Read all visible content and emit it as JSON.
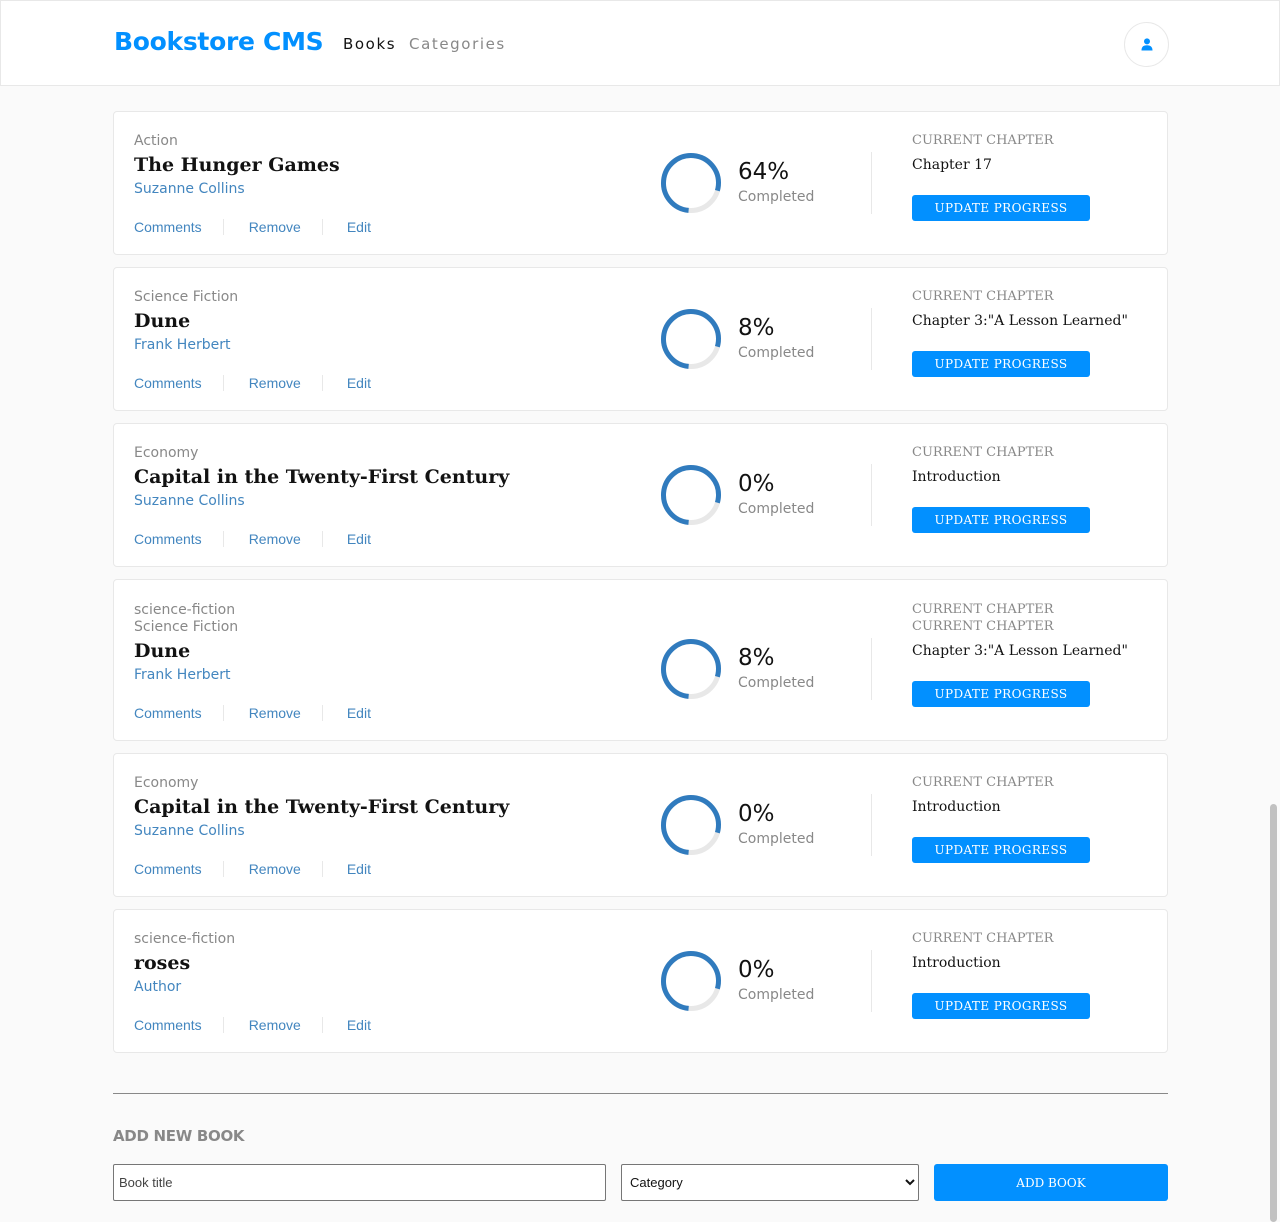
{
  "header": {
    "logo": "Bookstore CMS",
    "nav": [
      {
        "label": "Books",
        "active": true
      },
      {
        "label": "Categories",
        "active": false
      }
    ],
    "user_icon": "user-icon"
  },
  "books": [
    {
      "genre": "Action",
      "title": "The Hunger Games",
      "author": "Suzanne Collins",
      "progress": 64,
      "percent": "64%",
      "completed": "Completed",
      "chapter_label": "CURRENT CHAPTER",
      "chapter": "Chapter 17",
      "update_label": "UPDATE PROGRESS",
      "actions": {
        "comments": "Comments",
        "remove": "Remove",
        "edit": "Edit"
      }
    },
    {
      "genre": "Science Fiction",
      "title": "Dune",
      "author": "Frank Herbert",
      "progress": 8,
      "percent": "8%",
      "completed": "Completed",
      "chapter_label": "CURRENT CHAPTER",
      "chapter": "Chapter 3:\"A Lesson Learned\"",
      "update_label": "UPDATE PROGRESS",
      "actions": {
        "comments": "Comments",
        "remove": "Remove",
        "edit": "Edit"
      }
    },
    {
      "genre": "Economy",
      "title": "Capital in the Twenty-First Century",
      "author": "Suzanne Collins",
      "progress": 0,
      "percent": "0%",
      "completed": "Completed",
      "chapter_label": "CURRENT CHAPTER",
      "chapter": "Introduction",
      "update_label": "UPDATE PROGRESS",
      "actions": {
        "comments": "Comments",
        "remove": "Remove",
        "edit": "Edit"
      }
    },
    {
      "ghost_genre": "science-fiction",
      "ghost_chapter_label": "CURRENT CHAPTER",
      "genre": "Science Fiction",
      "title": "Dune",
      "author": "Frank Herbert",
      "progress": 8,
      "percent": "8%",
      "completed": "Completed",
      "chapter_label": "CURRENT CHAPTER",
      "chapter": "Chapter 3:\"A Lesson Learned\"",
      "update_label": "UPDATE PROGRESS",
      "actions": {
        "comments": "Comments",
        "remove": "Remove",
        "edit": "Edit"
      }
    },
    {
      "genre": "Economy",
      "title": "Capital in the Twenty-First Century",
      "author": "Suzanne Collins",
      "progress": 0,
      "percent": "0%",
      "completed": "Completed",
      "chapter_label": "CURRENT CHAPTER",
      "chapter": "Introduction",
      "update_label": "UPDATE PROGRESS",
      "actions": {
        "comments": "Comments",
        "remove": "Remove",
        "edit": "Edit"
      }
    },
    {
      "genre": "science-fiction",
      "title": "roses",
      "author": "Author",
      "progress": 0,
      "percent": "0%",
      "completed": "Completed",
      "chapter_label": "CURRENT CHAPTER",
      "chapter": "Introduction",
      "update_label": "UPDATE PROGRESS",
      "actions": {
        "comments": "Comments",
        "remove": "Remove",
        "edit": "Edit"
      }
    }
  ],
  "form": {
    "title": "ADD NEW BOOK",
    "title_placeholder": "Book title",
    "category_selected": "Category",
    "add_label": "ADD BOOK"
  },
  "colors": {
    "accent": "#0290ff",
    "author": "#4386bf",
    "muted": "#888888",
    "ring_track": "#e8e8e8",
    "ring_fill": "#307bbe"
  }
}
